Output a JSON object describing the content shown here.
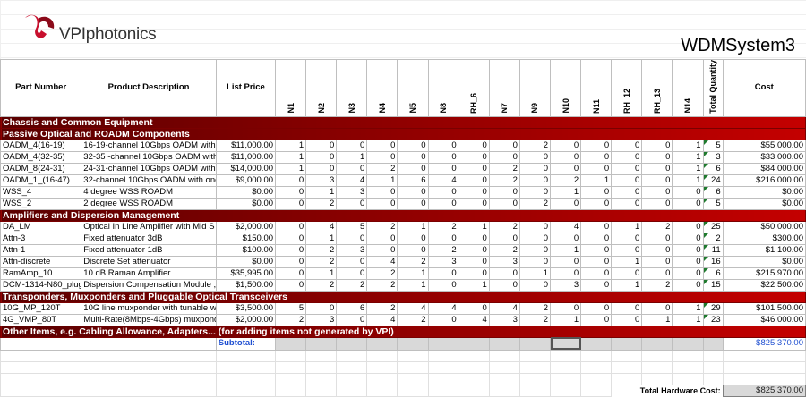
{
  "brand": {
    "name": "VPIphotonics"
  },
  "sheet_title": "WDMSystem3",
  "headers": [
    "Part Number",
    "Product Description",
    "List Price",
    "N1",
    "N2",
    "N3",
    "N4",
    "N5",
    "N8",
    "RH_6",
    "N7",
    "N9",
    "N10",
    "N11",
    "RH_12",
    "RH_13",
    "N14",
    "Total Quantity",
    "Cost"
  ],
  "rows": [
    {
      "type": "section",
      "label": "Chassis and Common Equipment"
    },
    {
      "type": "section",
      "label": "Passive Optical and ROADM Components"
    },
    {
      "type": "item",
      "part": "OADM_4(16-19)",
      "desc": "16-19-channel 10Gbps OADM with",
      "price": "$11,000.00",
      "q": [
        "1",
        "0",
        "0",
        "0",
        "0",
        "0",
        "0",
        "0",
        "2",
        "0",
        "0",
        "0",
        "0",
        "1"
      ],
      "total": "5",
      "cost": "$55,000.00"
    },
    {
      "type": "item",
      "part": "OADM_4(32-35)",
      "desc": "32-35 -channel 10Gbps OADM with",
      "price": "$11,000.00",
      "q": [
        "1",
        "0",
        "1",
        "0",
        "0",
        "0",
        "0",
        "0",
        "0",
        "0",
        "0",
        "0",
        "0",
        "1"
      ],
      "total": "3",
      "cost": "$33,000.00"
    },
    {
      "type": "item",
      "part": "OADM_8(24-31)",
      "desc": "24-31-channel 10Gbps OADM with",
      "price": "$14,000.00",
      "q": [
        "1",
        "0",
        "0",
        "2",
        "0",
        "0",
        "0",
        "2",
        "0",
        "0",
        "0",
        "0",
        "0",
        "1"
      ],
      "total": "6",
      "cost": "$84,000.00"
    },
    {
      "type": "item",
      "part": "OADM_1_(16-47)",
      "desc": "32-channel 10Gbps OADM with one",
      "price": "$9,000.00",
      "q": [
        "0",
        "3",
        "4",
        "1",
        "6",
        "4",
        "0",
        "2",
        "0",
        "2",
        "1",
        "0",
        "0",
        "1"
      ],
      "total": "24",
      "cost": "$216,000.00"
    },
    {
      "type": "item",
      "part": "WSS_4",
      "desc": "4 degree WSS ROADM",
      "price": "$0.00",
      "q": [
        "0",
        "1",
        "3",
        "0",
        "0",
        "0",
        "0",
        "0",
        "0",
        "1",
        "0",
        "0",
        "0",
        "0"
      ],
      "total": "6",
      "cost": "$0.00"
    },
    {
      "type": "item",
      "part": "WSS_2",
      "desc": "2 degree WSS ROADM",
      "price": "$0.00",
      "q": [
        "0",
        "2",
        "0",
        "0",
        "0",
        "0",
        "0",
        "0",
        "2",
        "0",
        "0",
        "0",
        "0",
        "0"
      ],
      "total": "5",
      "cost": "$0.00"
    },
    {
      "type": "section",
      "label": "Amplifiers and Dispersion Management"
    },
    {
      "type": "item",
      "part": "DA_LM",
      "desc": "Optical In Line Amplifier with Mid S",
      "price": "$2,000.00",
      "q": [
        "0",
        "4",
        "5",
        "2",
        "1",
        "2",
        "1",
        "2",
        "0",
        "4",
        "0",
        "1",
        "2",
        "0"
      ],
      "total": "25",
      "cost": "$50,000.00"
    },
    {
      "type": "item",
      "part": "Attn-3",
      "desc": "Fixed attenuator 3dB",
      "price": "$150.00",
      "q": [
        "0",
        "1",
        "0",
        "0",
        "0",
        "0",
        "0",
        "0",
        "0",
        "0",
        "0",
        "0",
        "0",
        "0"
      ],
      "total": "2",
      "cost": "$300.00"
    },
    {
      "type": "item",
      "part": "Attn-1",
      "desc": "Fixed attenuator 1dB",
      "price": "$100.00",
      "q": [
        "0",
        "2",
        "3",
        "0",
        "0",
        "2",
        "0",
        "2",
        "0",
        "1",
        "0",
        "0",
        "0",
        "0"
      ],
      "total": "11",
      "cost": "$1,100.00"
    },
    {
      "type": "item",
      "part": "Attn-discrete",
      "desc": "Discrete Set attenuator",
      "price": "$0.00",
      "q": [
        "0",
        "2",
        "0",
        "4",
        "2",
        "3",
        "0",
        "3",
        "0",
        "0",
        "0",
        "1",
        "0",
        "0"
      ],
      "total": "16",
      "cost": "$0.00"
    },
    {
      "type": "item",
      "part": "RamAmp_10",
      "desc": "10 dB Raman Amplifier",
      "price": "$35,995.00",
      "q": [
        "0",
        "1",
        "0",
        "2",
        "1",
        "0",
        "0",
        "0",
        "1",
        "0",
        "0",
        "0",
        "0",
        "0"
      ],
      "total": "6",
      "cost": "$215,970.00"
    },
    {
      "type": "item",
      "part": "DCM-1314-N80_plug",
      "desc": "Dispersion Compensation Module ,",
      "price": "$1,500.00",
      "q": [
        "0",
        "2",
        "2",
        "2",
        "1",
        "0",
        "1",
        "0",
        "0",
        "3",
        "0",
        "1",
        "2",
        "0"
      ],
      "total": "15",
      "cost": "$22,500.00"
    },
    {
      "type": "section",
      "label": "Transponders, Muxponders and Pluggable Optical Transceivers"
    },
    {
      "type": "item",
      "part": "10G_MP_120T",
      "desc": "10G line muxponder with tunable w",
      "price": "$3,500.00",
      "q": [
        "5",
        "0",
        "6",
        "2",
        "4",
        "4",
        "0",
        "4",
        "2",
        "0",
        "0",
        "0",
        "0",
        "1"
      ],
      "total": "29",
      "cost": "$101,500.00"
    },
    {
      "type": "item",
      "part": "4G_VMP_80T",
      "desc": "Multi-Rate(8Mbps-4Gbps) muxpond",
      "price": "$2,000.00",
      "q": [
        "2",
        "3",
        "0",
        "4",
        "2",
        "0",
        "4",
        "3",
        "2",
        "1",
        "0",
        "0",
        "1",
        "1"
      ],
      "total": "23",
      "cost": "$46,000.00"
    },
    {
      "type": "section",
      "label": "Other Items, e.g. Cabling Allowance, Adapters... (for adding items not generated by VPI)"
    }
  ],
  "subtotal": {
    "label": "Subtotal:",
    "value": "$825,370.00"
  },
  "total": {
    "label": "Total Hardware Cost:",
    "value": "$825,370.00"
  },
  "colors": {
    "section_dark": "#5a0000",
    "section_light": "#c40000",
    "link_blue": "#1f4fd1"
  }
}
